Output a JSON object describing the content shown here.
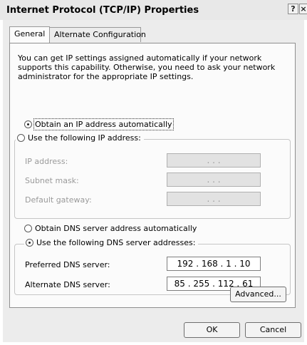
{
  "window": {
    "title": "Internet Protocol (TCP/IP) Properties",
    "help_glyph": "?",
    "close_glyph": "×"
  },
  "tabs": [
    {
      "label": "General"
    },
    {
      "label": "Alternate Configuration"
    }
  ],
  "description": "You can get IP settings assigned automatically if your network supports this capability. Otherwise, you need to ask your network administrator for the appropriate IP settings.",
  "ip_mode": {
    "auto_label": "Obtain an IP address automatically",
    "manual_label": "Use the following IP address:",
    "selected": "auto"
  },
  "ip_fields": [
    {
      "label": "IP address:",
      "value": ".       .       ."
    },
    {
      "label": "Subnet mask:",
      "value": ".       .       ."
    },
    {
      "label": "Default gateway:",
      "value": ".       .       ."
    }
  ],
  "dns_mode": {
    "auto_label": "Obtain DNS server address automatically",
    "manual_label": "Use the following DNS server addresses:",
    "selected": "manual"
  },
  "dns_fields": [
    {
      "label": "Preferred DNS server:",
      "value": "192 . 168 .  1  .  10"
    },
    {
      "label": "Alternate DNS server:",
      "value": "85  . 255 . 112 .  61"
    }
  ],
  "buttons": {
    "advanced": "Advanced...",
    "ok": "OK",
    "cancel": "Cancel"
  }
}
